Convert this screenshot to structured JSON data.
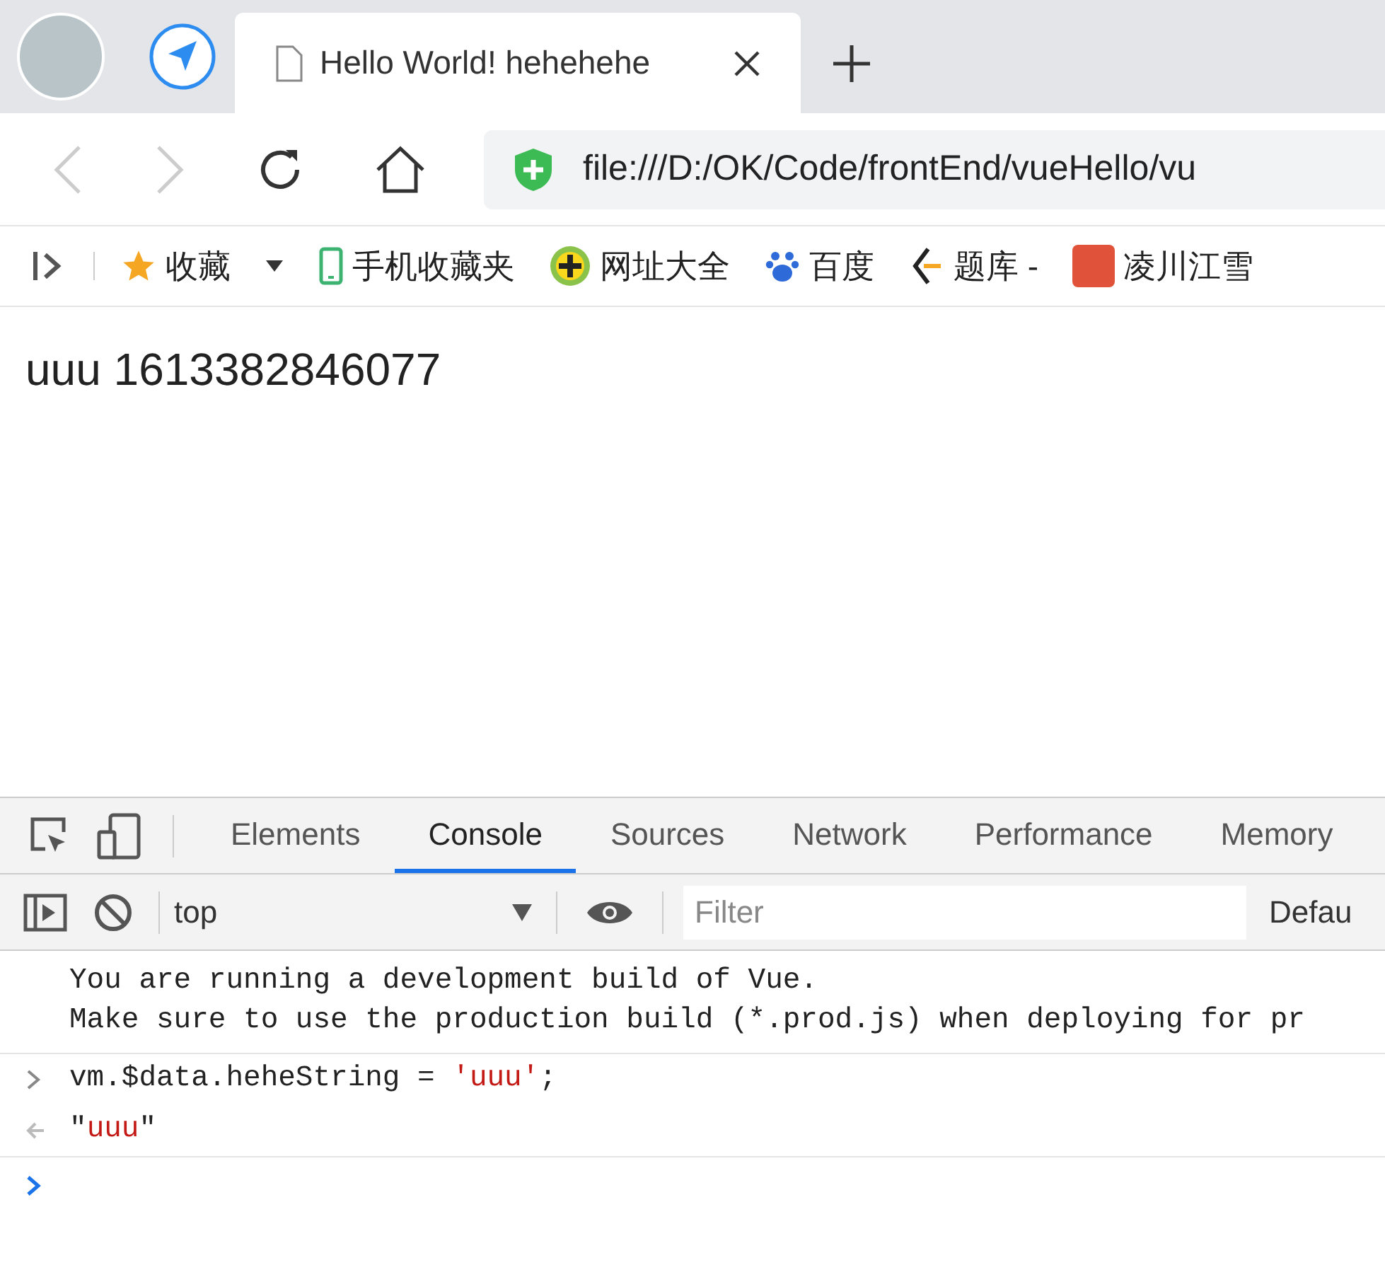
{
  "browser": {
    "tabs": [
      {
        "title": "Hello World! hehehehe",
        "selected": true
      }
    ],
    "url": "file:///D:/OK/Code/frontEnd/vueHello/vu"
  },
  "bookmarks": [
    {
      "label": "收藏",
      "kind": "star"
    },
    {
      "label": "手机收藏夹",
      "kind": "phone"
    },
    {
      "label": "网址大全",
      "kind": "plus"
    },
    {
      "label": "百度",
      "kind": "paw"
    },
    {
      "label": "题库 -",
      "kind": "bracket"
    },
    {
      "label": "凌川江雪",
      "kind": "jian"
    }
  ],
  "page": {
    "text": "uuu 1613382846077"
  },
  "devtools": {
    "tabs": [
      {
        "label": "Elements",
        "selected": false
      },
      {
        "label": "Console",
        "selected": true
      },
      {
        "label": "Sources",
        "selected": false
      },
      {
        "label": "Network",
        "selected": false
      },
      {
        "label": "Performance",
        "selected": false
      },
      {
        "label": "Memory",
        "selected": false
      }
    ],
    "context": "top",
    "filter_placeholder": "Filter",
    "levels": "Defau",
    "console": [
      {
        "kind": "log",
        "lines": [
          "You are running a development build of Vue.",
          "Make sure to use the production build (*.prod.js) when deploying for pr"
        ]
      },
      {
        "kind": "input",
        "parts": [
          {
            "kind": "code",
            "text": "vm.$data.heheString = "
          },
          {
            "kind": "string",
            "text": "'uuu'"
          },
          {
            "kind": "code",
            "text": ";"
          }
        ]
      },
      {
        "kind": "result",
        "parts": [
          {
            "kind": "code",
            "text": "\""
          },
          {
            "kind": "string",
            "text": "uuu"
          },
          {
            "kind": "code",
            "text": "\""
          }
        ]
      },
      {
        "kind": "prompt"
      }
    ]
  }
}
